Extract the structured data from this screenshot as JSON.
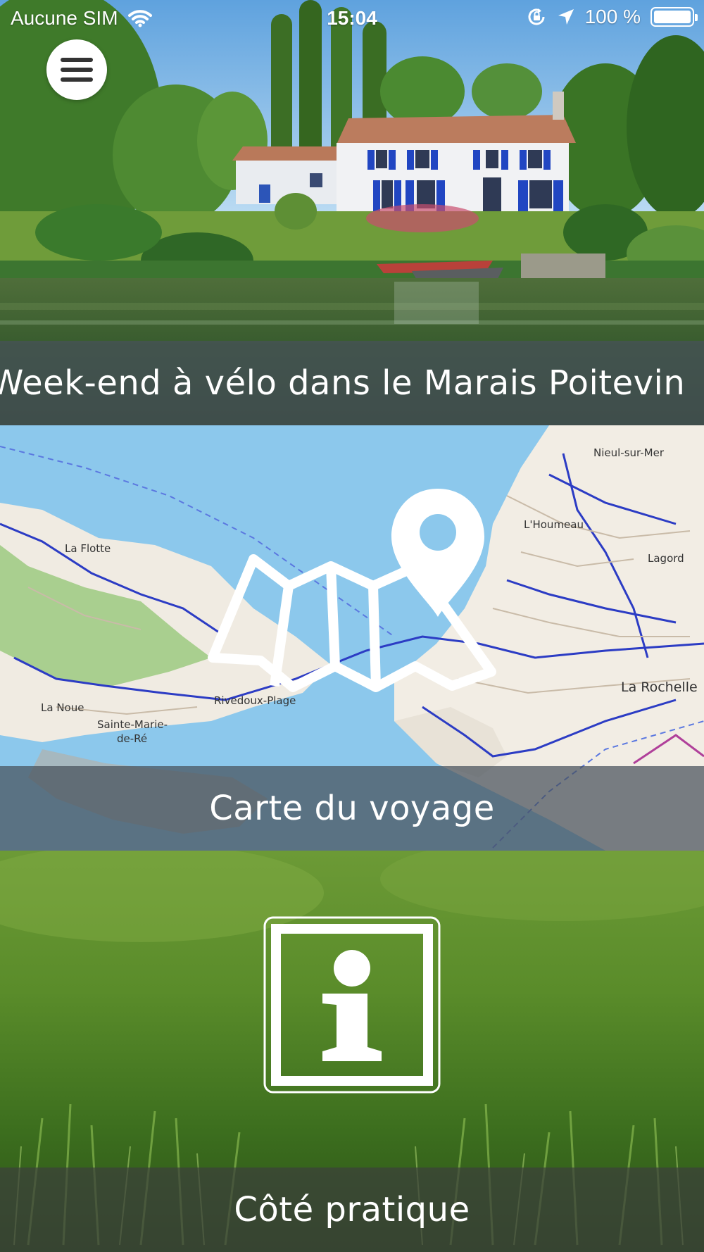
{
  "status_bar": {
    "carrier": "Aucune SIM",
    "time": "15:04",
    "battery_percent": "100 %",
    "icons": [
      "wifi-icon",
      "orientation-lock-icon",
      "location-arrow-icon",
      "battery-icon"
    ]
  },
  "menu": {
    "icon": "hamburger-menu-icon"
  },
  "tiles": [
    {
      "title": "Week-end à vélo dans le Marais Poitevin",
      "image": "house-by-canal-photo"
    },
    {
      "title": "Carte du voyage",
      "icon": "map-pin-icon",
      "map_labels": [
        "Nieul-sur-Mer",
        "L'Houmeau",
        "Lagord",
        "La Flotte",
        "Rivedoux-Plage",
        "La Rochelle",
        "La Noue",
        "Sainte-Marie-",
        "de-Ré"
      ]
    },
    {
      "title": "Côté pratique",
      "icon": "info-icon",
      "image": "grass-photo"
    }
  ],
  "colors": {
    "banner_overlay": "#46505a",
    "sea": "#8cc8ec",
    "land": "#f2ede4",
    "grass": "#6a9a2c"
  }
}
